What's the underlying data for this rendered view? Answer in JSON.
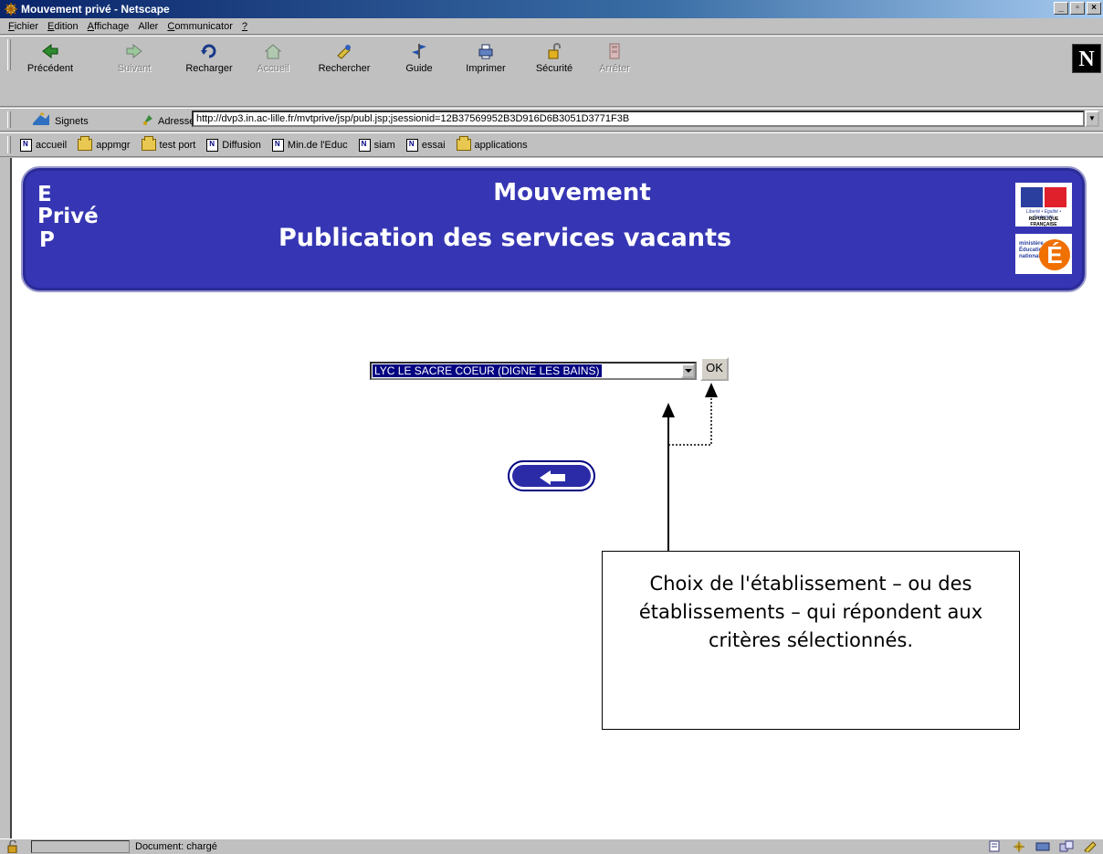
{
  "window": {
    "title": "Mouvement privé - Netscape"
  },
  "menu": [
    {
      "label": "Fichier",
      "underline": "F",
      "rest": "ichier"
    },
    {
      "label": "Edition",
      "underline": "E",
      "rest": "dition"
    },
    {
      "label": "Affichage",
      "underline": "A",
      "rest": "ffichage"
    },
    {
      "label": "Aller",
      "underline": "",
      "rest": "Aller"
    },
    {
      "label": "Communicator",
      "underline": "C",
      "rest": "ommunicator"
    },
    {
      "label": "?",
      "underline": "?",
      "rest": ""
    }
  ],
  "toolbar": {
    "precedent": "Précédent",
    "suivant": "Suivant",
    "recharger": "Recharger",
    "accueil": "Accueil",
    "rechercher": "Rechercher",
    "guide": "Guide",
    "imprimer": "Imprimer",
    "securite": "Sécurité",
    "arreter": "Arrêter"
  },
  "location": {
    "signets_label": "Signets",
    "address_label": "Adresse:",
    "url": "http://dvp3.in.ac-lille.fr/mvtprive/jsp/publ.jsp;jsessionid=12B37569952B3D916D6B3051D3771F3B"
  },
  "personal_toolbar": [
    {
      "label": "accueil",
      "icon": "page-icon"
    },
    {
      "label": "appmgr",
      "icon": "folder-icon"
    },
    {
      "label": "test port",
      "icon": "folder-icon"
    },
    {
      "label": "Diffusion",
      "icon": "page-icon"
    },
    {
      "label": "Min.de l'Educ",
      "icon": "page-icon"
    },
    {
      "label": "siam",
      "icon": "page-icon"
    },
    {
      "label": "essai",
      "icon": "page-icon"
    },
    {
      "label": "applications",
      "icon": "folder-icon"
    }
  ],
  "banner": {
    "logo_e": "E",
    "logo_prive": "Privé",
    "logo_p": "P",
    "title": "Mouvement",
    "subtitle": "Publication des services vacants",
    "flag_motto": "Liberté • Égalité • Fraternité",
    "flag_name": "RÉPUBLIQUE FRANÇAISE",
    "ministry_text": "ministère Éducation nationale",
    "ministry_letter": "É"
  },
  "form": {
    "selected_establishment": "LYC LE SACRE COEUR (DIGNE LES BAINS)",
    "ok_label": "OK"
  },
  "callout": {
    "text": "Choix de l'établissement – ou des établissements – qui répondent aux critères sélectionnés."
  },
  "status": {
    "text": "Document: chargé"
  },
  "colors": {
    "banner_bg": "#3636b4",
    "selection": "#000080",
    "titlebar": "#0a246a"
  }
}
